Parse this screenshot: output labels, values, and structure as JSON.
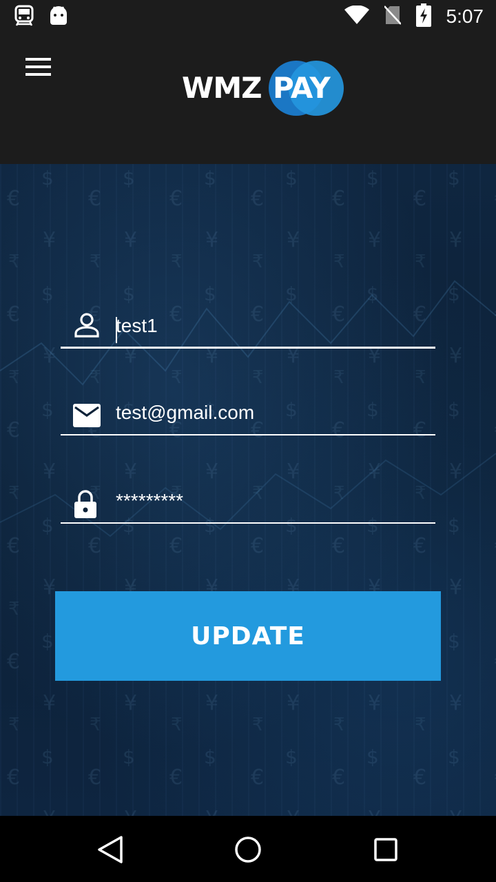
{
  "status_bar": {
    "time": "5:07",
    "icons": [
      "train-notification-icon",
      "android-notification-icon",
      "wifi-icon",
      "no-sim-icon",
      "battery-charging-icon"
    ]
  },
  "header": {
    "logo_text_left": "WMZ",
    "logo_text_right": "PAY",
    "menu_icon": "hamburger-menu-icon"
  },
  "form": {
    "username": {
      "value": "test1",
      "icon": "user-icon"
    },
    "email": {
      "value": "test@gmail.com",
      "icon": "email-icon"
    },
    "password": {
      "value": "*********",
      "icon": "lock-icon"
    },
    "submit_label": "UPDATE"
  },
  "nav_bar": {
    "buttons": [
      "back-icon",
      "home-icon",
      "recents-icon"
    ]
  },
  "colors": {
    "accent": "#239ade",
    "header_bg": "#1c1c1c",
    "page_bg": "#0d2238"
  }
}
